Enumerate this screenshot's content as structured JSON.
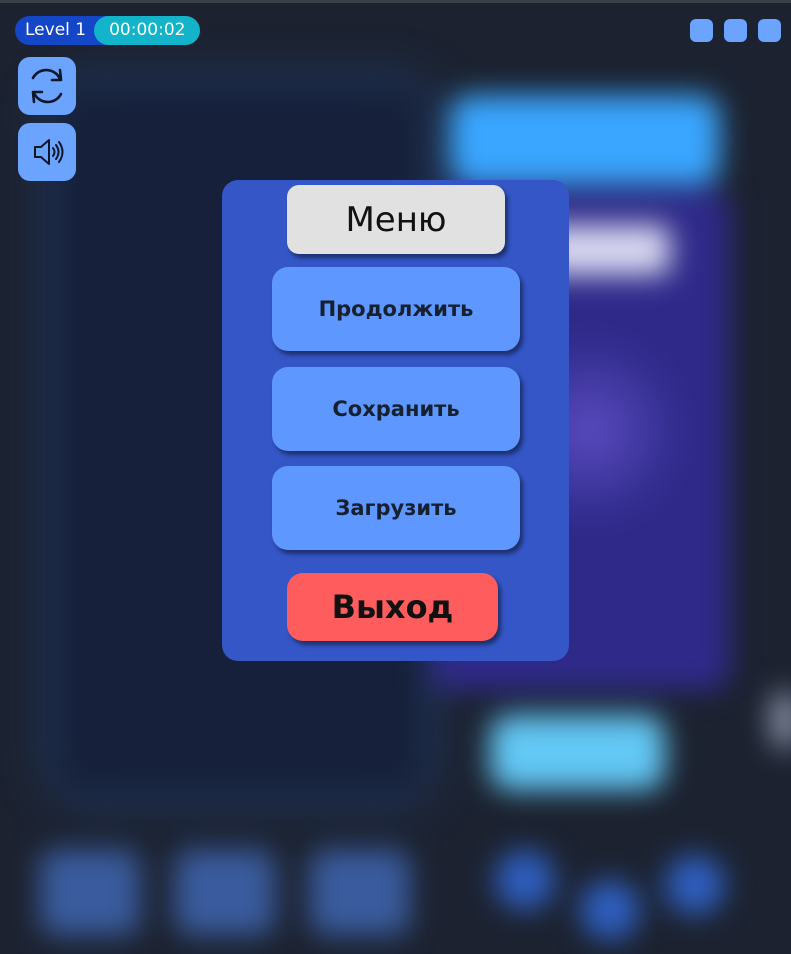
{
  "hud": {
    "level_label": "Level 1",
    "timer": "00:00:02"
  },
  "side_buttons": {
    "restart_icon": "refresh-icon",
    "sound_icon": "speaker-icon"
  },
  "menu": {
    "title": "Меню",
    "continue_label": "Продолжить",
    "save_label": "Сохранить",
    "load_label": "Загрузить",
    "exit_label": "Выход"
  },
  "colors": {
    "panel": "#3456c7",
    "button": "#5d97ff",
    "exit": "#ff5d5d",
    "title_bg": "#e1e1e1",
    "level_pill": "#1446c8",
    "timer_pill": "#13b3c9"
  }
}
